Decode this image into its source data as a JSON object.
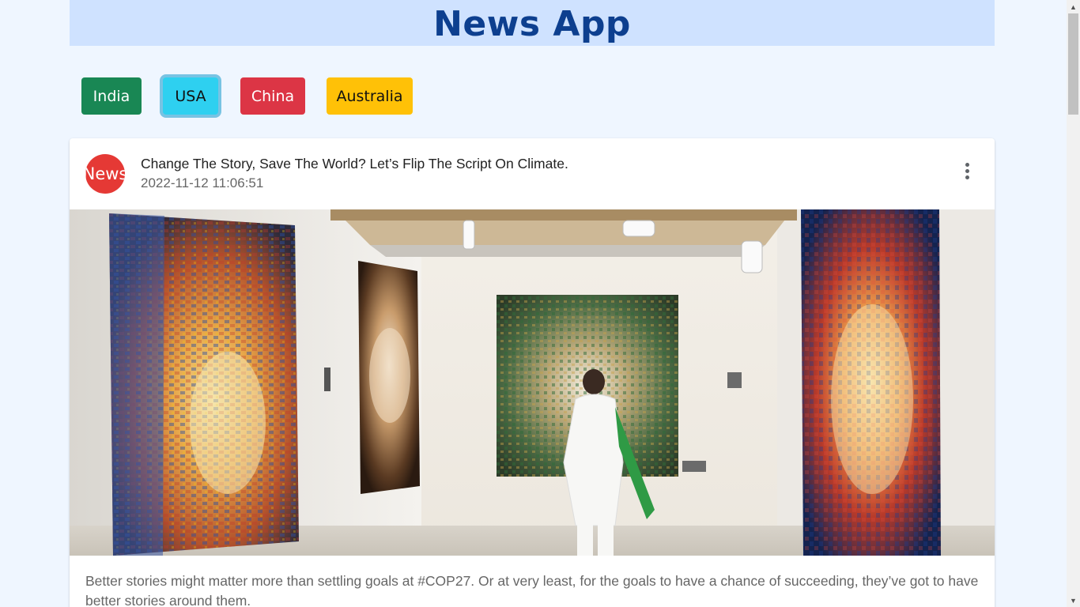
{
  "app": {
    "title": "News App"
  },
  "countries": [
    {
      "label": "India",
      "color": "#198754"
    },
    {
      "label": "USA",
      "color": "#2ed0f0",
      "active": true
    },
    {
      "label": "China",
      "color": "#dc3545"
    },
    {
      "label": "Australia",
      "color": "#ffc107"
    }
  ],
  "article": {
    "avatar_text": "News",
    "title": "Change The Story, Save The World? Let’s Flip The Script On Climate.",
    "date": "2022-11-12 11:06:51",
    "description": "Better stories might matter more than settling goals at #COP27. Or at very least, for the goals to have a chance of succeeding, they’ve got to have better stories around them.",
    "menu_icon": "more-vert-icon"
  },
  "colors": {
    "page_bg": "#eff6ff",
    "header_bg": "#cfe2ff",
    "title": "#0d3f8f",
    "avatar": "#e53935"
  }
}
